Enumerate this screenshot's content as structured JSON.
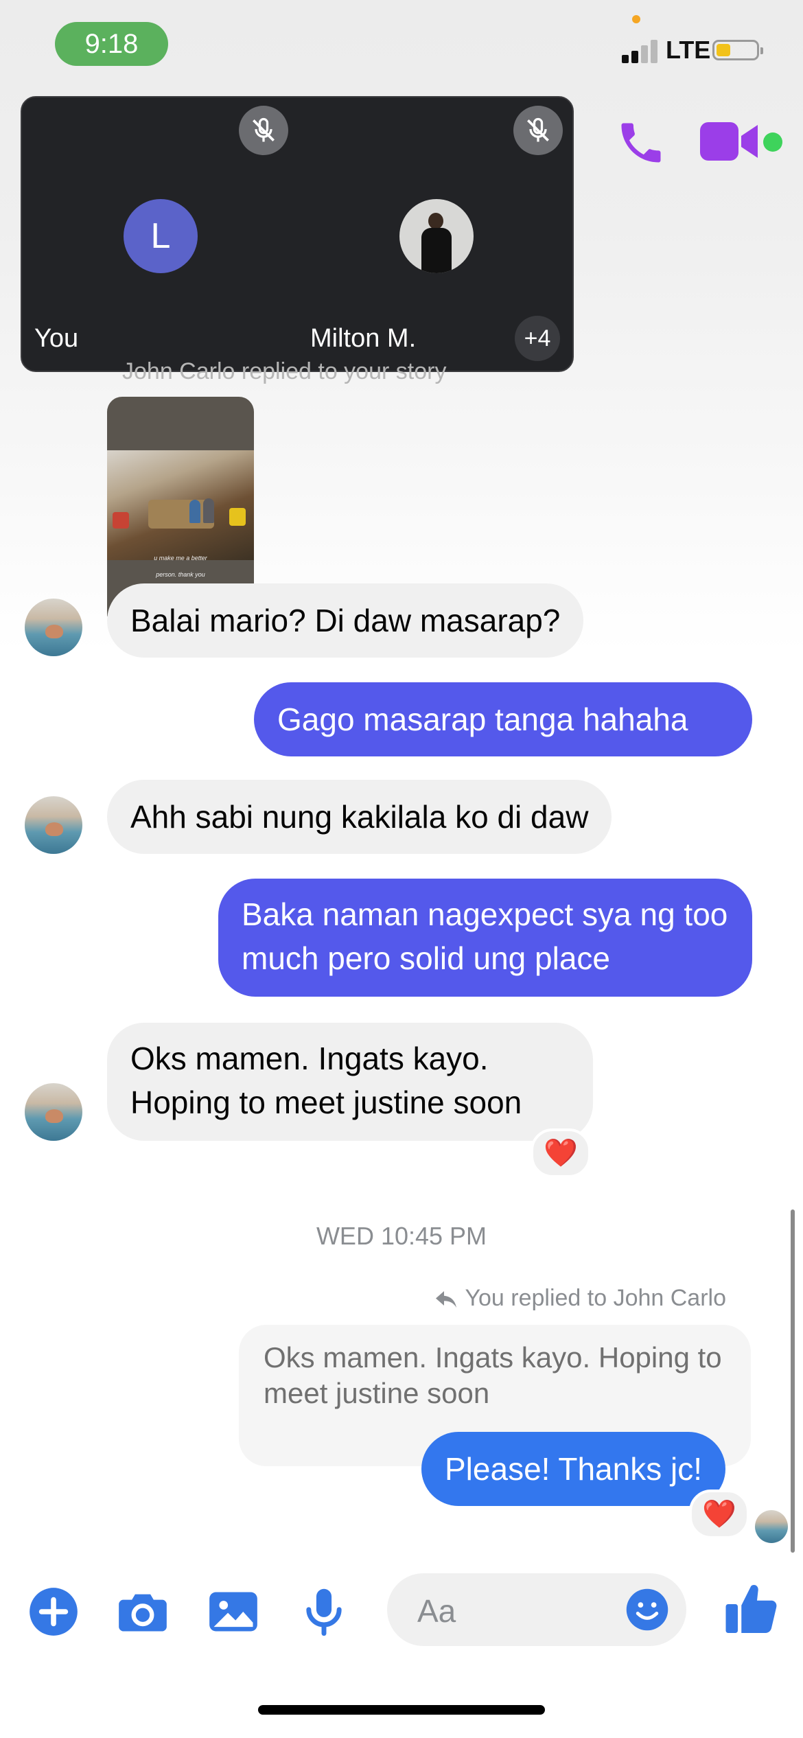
{
  "status_bar": {
    "time": "9:18",
    "network": "LTE"
  },
  "call_overlay": {
    "participants": [
      {
        "name": "You",
        "initial": "L"
      },
      {
        "name": "Milton M."
      }
    ],
    "more_count": "+4"
  },
  "conversation": {
    "story_reply_label": "John Carlo replied to your story",
    "story_caption_1": "u make me a better",
    "story_caption_2": "person. thank you",
    "messages": [
      {
        "from": "them",
        "text": "Balai mario? Di daw masarap?"
      },
      {
        "from": "me",
        "text": "Gago masarap tanga hahaha"
      },
      {
        "from": "them",
        "text": "Ahh sabi nung kakilala ko di daw"
      },
      {
        "from": "me",
        "text": "Baka naman nagexpect sya ng too much pero solid ung place"
      },
      {
        "from": "them",
        "text": "Oks mamen. Ingats kayo. Hoping to meet justine soon",
        "reaction": "❤️"
      }
    ],
    "timestamp": "WED 10:45 PM",
    "reply_label": "You replied to John Carlo",
    "quoted_text": "Oks mamen. Ingats kayo. Hoping to meet justine soon",
    "reply_message": {
      "text": "Please! Thanks jc!",
      "reaction": "❤️"
    }
  },
  "composer": {
    "placeholder": "Aa"
  },
  "colors": {
    "outgoing_bubble": "#5459eb",
    "reply_bubble": "#3377ee",
    "incoming_bubble": "#f0f0f0",
    "accent": "#3578e5",
    "call_purple": "#9b3ee8"
  }
}
